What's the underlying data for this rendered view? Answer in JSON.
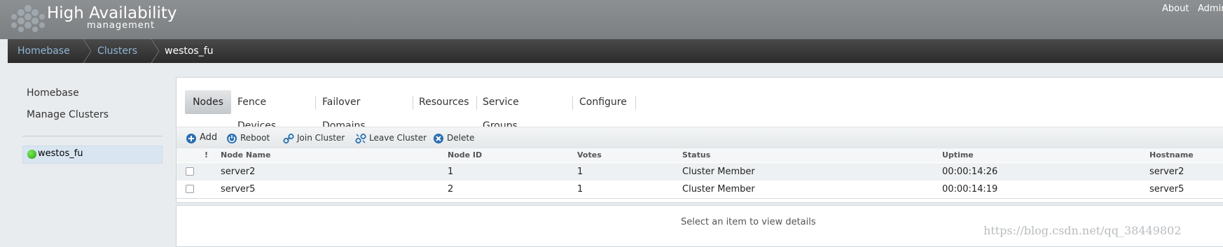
{
  "header": {
    "title": "High Availability",
    "subtitle": "management",
    "links": [
      "About",
      "Admin"
    ]
  },
  "breadcrumb": [
    "Homebase",
    "Clusters",
    "westos_fu"
  ],
  "sidebar": {
    "links": [
      "Homebase",
      "Manage Clusters"
    ],
    "cluster": "westos_fu"
  },
  "tabs": [
    "Nodes",
    "Fence Devices",
    "Failover Domains",
    "Resources",
    "Service Groups",
    "Configure"
  ],
  "toolbar": [
    "Add",
    "Reboot",
    "Join Cluster",
    "Leave Cluster",
    "Delete"
  ],
  "table": {
    "columns": [
      "!",
      "Node Name",
      "Node ID",
      "Votes",
      "Status",
      "Uptime",
      "Hostname"
    ],
    "rows": [
      [
        "server2",
        "1",
        "1",
        "Cluster Member",
        "00:00:14:26",
        "server2"
      ],
      [
        "server5",
        "2",
        "1",
        "Cluster Member",
        "00:00:14:19",
        "server5"
      ]
    ]
  },
  "details": "Select an item to view details",
  "watermark": "https://blog.csdn.net/qq_38449802",
  "colors": {
    "crumb_link": "#8fb4d6",
    "status_dot": "#2a9d15",
    "action_icon": "#2a6fb0"
  },
  "icons": {
    "logo": "honeycomb-logo",
    "add": "plus-circle-icon",
    "reboot": "power-icon",
    "join": "link-icon",
    "leave": "unlink-icon",
    "delete": "x-circle-icon"
  }
}
